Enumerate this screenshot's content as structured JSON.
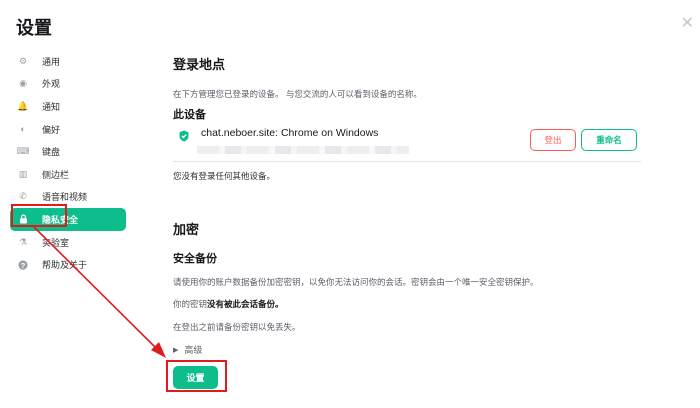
{
  "window": {
    "title": "设置",
    "close_glyph": "✕"
  },
  "sidebar": {
    "items": [
      {
        "label": "通用",
        "icon": "gear-icon",
        "glyph": "⚙"
      },
      {
        "label": "外观",
        "icon": "eye-icon",
        "glyph": "◉"
      },
      {
        "label": "通知",
        "icon": "bell-icon",
        "glyph": "🔔"
      },
      {
        "label": "偏好",
        "icon": "toggle-icon",
        "glyph": "◐"
      },
      {
        "label": "键盘",
        "icon": "keyboard-icon",
        "glyph": "⌨"
      },
      {
        "label": "侧边栏",
        "icon": "sidebar-icon",
        "glyph": "▥"
      },
      {
        "label": "语音和视频",
        "icon": "phone-icon",
        "glyph": "✆"
      },
      {
        "label": "隐私安全",
        "icon": "lock-icon",
        "glyph": "🔒",
        "active": true
      },
      {
        "label": "实验室",
        "icon": "flask-icon",
        "glyph": "⚗"
      },
      {
        "label": "帮助及关于",
        "icon": "help-icon",
        "glyph": "?"
      }
    ]
  },
  "sessions": {
    "heading": "登录地点",
    "description": "在下方管理您已登录的设备。 与您交流的人可以看到设备的名称。",
    "this_device_heading": "此设备",
    "device_name": "chat.neboer.site: Chrome on Windows",
    "sign_out_label": "登出",
    "rename_label": "重命名",
    "no_other_devices": "您没有登录任何其他设备。"
  },
  "encryption": {
    "heading": "加密",
    "backup_heading": "安全备份",
    "backup_desc": "请使用你的账户数据备份加密密钥，以免你无法访问你的会话。密钥会由一个唯一安全密钥保护。",
    "status_prefix": "你的密钥",
    "status_bold": "没有被此会话备份。",
    "backup_hint": "在登出之前请备份密钥以免丢失。",
    "advanced_label": "高级",
    "setup_label": "设置"
  },
  "colors": {
    "accent": "#0dbd8b",
    "danger": "#ff5b55",
    "annotation": "#e01b1b"
  }
}
